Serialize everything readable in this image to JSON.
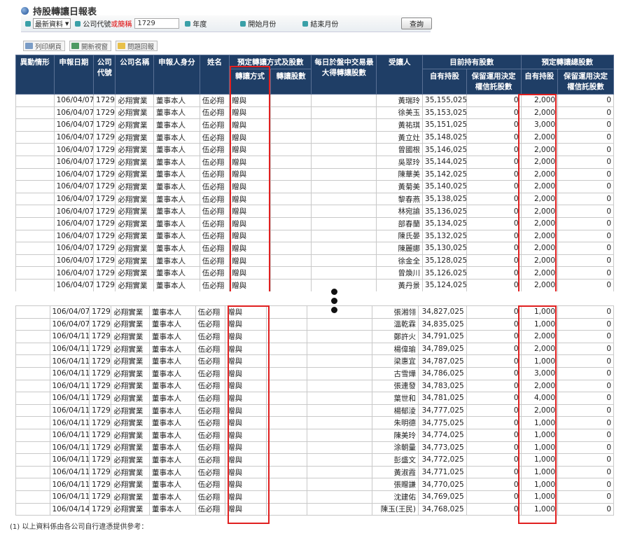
{
  "page": {
    "title": "持股轉讓日報表"
  },
  "query": {
    "mode_select": "最新資料",
    "company_code_label": "公司代號",
    "company_abbr_label": "或簡稱",
    "company_code_value": "1729",
    "year_label": "年度",
    "start_month_label": "開始月份",
    "end_month_label": "結束月份",
    "query_button": "查詢"
  },
  "toolbar": {
    "print": "列印網頁",
    "open_window": "開新視窗",
    "report_issue": "問題回報"
  },
  "headers": {
    "change": "異動情形",
    "report_date": "申報日期",
    "company_code_a": "公司",
    "company_code_b": "代號",
    "company_name": "公司名稱",
    "reporter_role": "申報人身分",
    "name": "姓名",
    "planned_group": "預定轉讓方式及股數",
    "transfer_method": "轉讓方式",
    "transfer_shares": "轉讓股數",
    "daily_max": "每日於盤中交易最大得轉讓股數",
    "transferee": "受讓人",
    "current_group": "目前持有股數",
    "own_shares": "自有持股",
    "trust_shares_a": "保留運用決定",
    "trust_shares_b": "權信託股數",
    "planned_total_group": "預定轉讓總股數",
    "planned_own": "自有持股",
    "planned_trust_a": "保留運用決定",
    "planned_trust_b": "權信託股數"
  },
  "top_rows": [
    {
      "date": "106/04/07",
      "code": "1729",
      "company": "必翔實業",
      "role": "董事本人",
      "name": "伍必翔",
      "method": "贈與",
      "transferee": "黃瑞玲",
      "current": "35,155,025",
      "current_trust": "0",
      "planned": "2,000",
      "planned_trust": "0"
    },
    {
      "date": "106/04/07",
      "code": "1729",
      "company": "必翔實業",
      "role": "董事本人",
      "name": "伍必翔",
      "method": "贈與",
      "transferee": "徐美玉",
      "current": "35,153,025",
      "current_trust": "0",
      "planned": "2,000",
      "planned_trust": "0"
    },
    {
      "date": "106/04/07",
      "code": "1729",
      "company": "必翔實業",
      "role": "董事本人",
      "name": "伍必翔",
      "method": "贈與",
      "transferee": "黃祐琪",
      "current": "35,151,025",
      "current_trust": "0",
      "planned": "3,000",
      "planned_trust": "0"
    },
    {
      "date": "106/04/07",
      "code": "1729",
      "company": "必翔實業",
      "role": "董事本人",
      "name": "伍必翔",
      "method": "贈與",
      "transferee": "黃立灶",
      "current": "35,148,025",
      "current_trust": "0",
      "planned": "2,000",
      "planned_trust": "0"
    },
    {
      "date": "106/04/07",
      "code": "1729",
      "company": "必翔實業",
      "role": "董事本人",
      "name": "伍必翔",
      "method": "贈與",
      "transferee": "曾國根",
      "current": "35,146,025",
      "current_trust": "0",
      "planned": "2,000",
      "planned_trust": "0"
    },
    {
      "date": "106/04/07",
      "code": "1729",
      "company": "必翔實業",
      "role": "董事本人",
      "name": "伍必翔",
      "method": "贈與",
      "transferee": "吳翠玲",
      "current": "35,144,025",
      "current_trust": "0",
      "planned": "2,000",
      "planned_trust": "0"
    },
    {
      "date": "106/04/07",
      "code": "1729",
      "company": "必翔實業",
      "role": "董事本人",
      "name": "伍必翔",
      "method": "贈與",
      "transferee": "陳華美",
      "current": "35,142,025",
      "current_trust": "0",
      "planned": "2,000",
      "planned_trust": "0"
    },
    {
      "date": "106/04/07",
      "code": "1729",
      "company": "必翔實業",
      "role": "董事本人",
      "name": "伍必翔",
      "method": "贈與",
      "transferee": "黃菊美",
      "current": "35,140,025",
      "current_trust": "0",
      "planned": "2,000",
      "planned_trust": "0"
    },
    {
      "date": "106/04/07",
      "code": "1729",
      "company": "必翔實業",
      "role": "董事本人",
      "name": "伍必翔",
      "method": "贈與",
      "transferee": "黎春燕",
      "current": "35,138,025",
      "current_trust": "0",
      "planned": "2,000",
      "planned_trust": "0"
    },
    {
      "date": "106/04/07",
      "code": "1729",
      "company": "必翔實業",
      "role": "董事本人",
      "name": "伍必翔",
      "method": "贈與",
      "transferee": "林宛諭",
      "current": "35,136,025",
      "current_trust": "0",
      "planned": "2,000",
      "planned_trust": "0"
    },
    {
      "date": "106/04/07",
      "code": "1729",
      "company": "必翔實業",
      "role": "董事本人",
      "name": "伍必翔",
      "method": "贈與",
      "transferee": "部春蘭",
      "current": "35,134,025",
      "current_trust": "0",
      "planned": "2,000",
      "planned_trust": "0"
    },
    {
      "date": "106/04/07",
      "code": "1729",
      "company": "必翔實業",
      "role": "董事本人",
      "name": "伍必翔",
      "method": "贈與",
      "transferee": "陳氏晏",
      "current": "35,132,025",
      "current_trust": "0",
      "planned": "2,000",
      "planned_trust": "0"
    },
    {
      "date": "106/04/07",
      "code": "1729",
      "company": "必翔實業",
      "role": "董事本人",
      "name": "伍必翔",
      "method": "贈與",
      "transferee": "陳麗娜",
      "current": "35,130,025",
      "current_trust": "0",
      "planned": "2,000",
      "planned_trust": "0"
    },
    {
      "date": "106/04/07",
      "code": "1729",
      "company": "必翔實業",
      "role": "董事本人",
      "name": "伍必翔",
      "method": "贈與",
      "transferee": "徐金全",
      "current": "35,128,025",
      "current_trust": "0",
      "planned": "2,000",
      "planned_trust": "0"
    },
    {
      "date": "106/04/07",
      "code": "1729",
      "company": "必翔實業",
      "role": "董事本人",
      "name": "伍必翔",
      "method": "贈與",
      "transferee": "曾煥川",
      "current": "35,126,025",
      "current_trust": "0",
      "planned": "2,000",
      "planned_trust": "0"
    },
    {
      "date": "106/04/07",
      "code": "1729",
      "company": "必翔實業",
      "role": "董事本人",
      "name": "伍必翔",
      "method": "贈與",
      "transferee": "黃丹景",
      "current": "35,124,025",
      "current_trust": "0",
      "planned": "2,000",
      "planned_trust": "0"
    }
  ],
  "bottom_rows": [
    {
      "date": "106/04/07",
      "code": "1729",
      "company": "必翔實業",
      "role": "董事本人",
      "name": "伍必翔",
      "method": "贈與",
      "transferee": "張湘翎",
      "current": "34,827,025",
      "current_trust": "0",
      "planned": "1,000",
      "planned_trust": "0"
    },
    {
      "date": "106/04/07",
      "code": "1729",
      "company": "必翔實業",
      "role": "董事本人",
      "name": "伍必翔",
      "method": "贈與",
      "transferee": "溫乾霖",
      "current": "34,835,025",
      "current_trust": "0",
      "planned": "1,000",
      "planned_trust": "0"
    },
    {
      "date": "106/04/11",
      "code": "1729",
      "company": "必翔實業",
      "role": "董事本人",
      "name": "伍必翔",
      "method": "贈與",
      "transferee": "鄭許火",
      "current": "34,791,025",
      "current_trust": "0",
      "planned": "2,000",
      "planned_trust": "0"
    },
    {
      "date": "106/04/11",
      "code": "1729",
      "company": "必翔實業",
      "role": "董事本人",
      "name": "伍必翔",
      "method": "贈與",
      "transferee": "楊偉瑜",
      "current": "34,789,025",
      "current_trust": "0",
      "planned": "2,000",
      "planned_trust": "0"
    },
    {
      "date": "106/04/11",
      "code": "1729",
      "company": "必翔實業",
      "role": "董事本人",
      "name": "伍必翔",
      "method": "贈與",
      "transferee": "梁惠宜",
      "current": "34,787,025",
      "current_trust": "0",
      "planned": "1,000",
      "planned_trust": "0"
    },
    {
      "date": "106/04/11",
      "code": "1729",
      "company": "必翔實業",
      "role": "董事本人",
      "name": "伍必翔",
      "method": "贈與",
      "transferee": "古雪燁",
      "current": "34,786,025",
      "current_trust": "0",
      "planned": "3,000",
      "planned_trust": "0"
    },
    {
      "date": "106/04/11",
      "code": "1729",
      "company": "必翔實業",
      "role": "董事本人",
      "name": "伍必翔",
      "method": "贈與",
      "transferee": "張連發",
      "current": "34,783,025",
      "current_trust": "0",
      "planned": "2,000",
      "planned_trust": "0"
    },
    {
      "date": "106/04/11",
      "code": "1729",
      "company": "必翔實業",
      "role": "董事本人",
      "name": "伍必翔",
      "method": "贈與",
      "transferee": "葉世和",
      "current": "34,781,025",
      "current_trust": "0",
      "planned": "4,000",
      "planned_trust": "0"
    },
    {
      "date": "106/04/11",
      "code": "1729",
      "company": "必翔實業",
      "role": "董事本人",
      "name": "伍必翔",
      "method": "贈與",
      "transferee": "楊郁淩",
      "current": "34,777,025",
      "current_trust": "0",
      "planned": "2,000",
      "planned_trust": "0"
    },
    {
      "date": "106/04/11",
      "code": "1729",
      "company": "必翔實業",
      "role": "董事本人",
      "name": "伍必翔",
      "method": "贈與",
      "transferee": "朱明德",
      "current": "34,775,025",
      "current_trust": "0",
      "planned": "1,000",
      "planned_trust": "0"
    },
    {
      "date": "106/04/11",
      "code": "1729",
      "company": "必翔實業",
      "role": "董事本人",
      "name": "伍必翔",
      "method": "贈與",
      "transferee": "陳美玲",
      "current": "34,774,025",
      "current_trust": "0",
      "planned": "1,000",
      "planned_trust": "0"
    },
    {
      "date": "106/04/11",
      "code": "1729",
      "company": "必翔實業",
      "role": "董事本人",
      "name": "伍必翔",
      "method": "贈與",
      "transferee": "涂朝量",
      "current": "34,773,025",
      "current_trust": "0",
      "planned": "1,000",
      "planned_trust": "0"
    },
    {
      "date": "106/04/11",
      "code": "1729",
      "company": "必翔實業",
      "role": "董事本人",
      "name": "伍必翔",
      "method": "贈與",
      "transferee": "彭盛文",
      "current": "34,772,025",
      "current_trust": "0",
      "planned": "1,000",
      "planned_trust": "0"
    },
    {
      "date": "106/04/11",
      "code": "1729",
      "company": "必翔實業",
      "role": "董事本人",
      "name": "伍必翔",
      "method": "贈與",
      "transferee": "黃淑霞",
      "current": "34,771,025",
      "current_trust": "0",
      "planned": "1,000",
      "planned_trust": "0"
    },
    {
      "date": "106/04/11",
      "code": "1729",
      "company": "必翔實業",
      "role": "董事本人",
      "name": "伍必翔",
      "method": "贈與",
      "transferee": "張贈謙",
      "current": "34,770,025",
      "current_trust": "0",
      "planned": "1,000",
      "planned_trust": "0"
    },
    {
      "date": "106/04/11",
      "code": "1729",
      "company": "必翔實業",
      "role": "董事本人",
      "name": "伍必翔",
      "method": "贈與",
      "transferee": "沈建佑",
      "current": "34,769,025",
      "current_trust": "0",
      "planned": "1,000",
      "planned_trust": "0"
    },
    {
      "date": "106/04/14",
      "code": "1729",
      "company": "必翔實業",
      "role": "董事本人",
      "name": "伍必翔",
      "method": "贈與",
      "transferee": "陳玉(王民)",
      "current": "34,768,025",
      "current_trust": "0",
      "planned": "1,000",
      "planned_trust": "0"
    }
  ],
  "footer": {
    "note1": "(1) 以上資料係由各公司自行違憑提供參考："
  },
  "colors": {
    "header_bg": "#1f3e66",
    "highlight": "#e02020",
    "accent": "#3aa0a8"
  }
}
